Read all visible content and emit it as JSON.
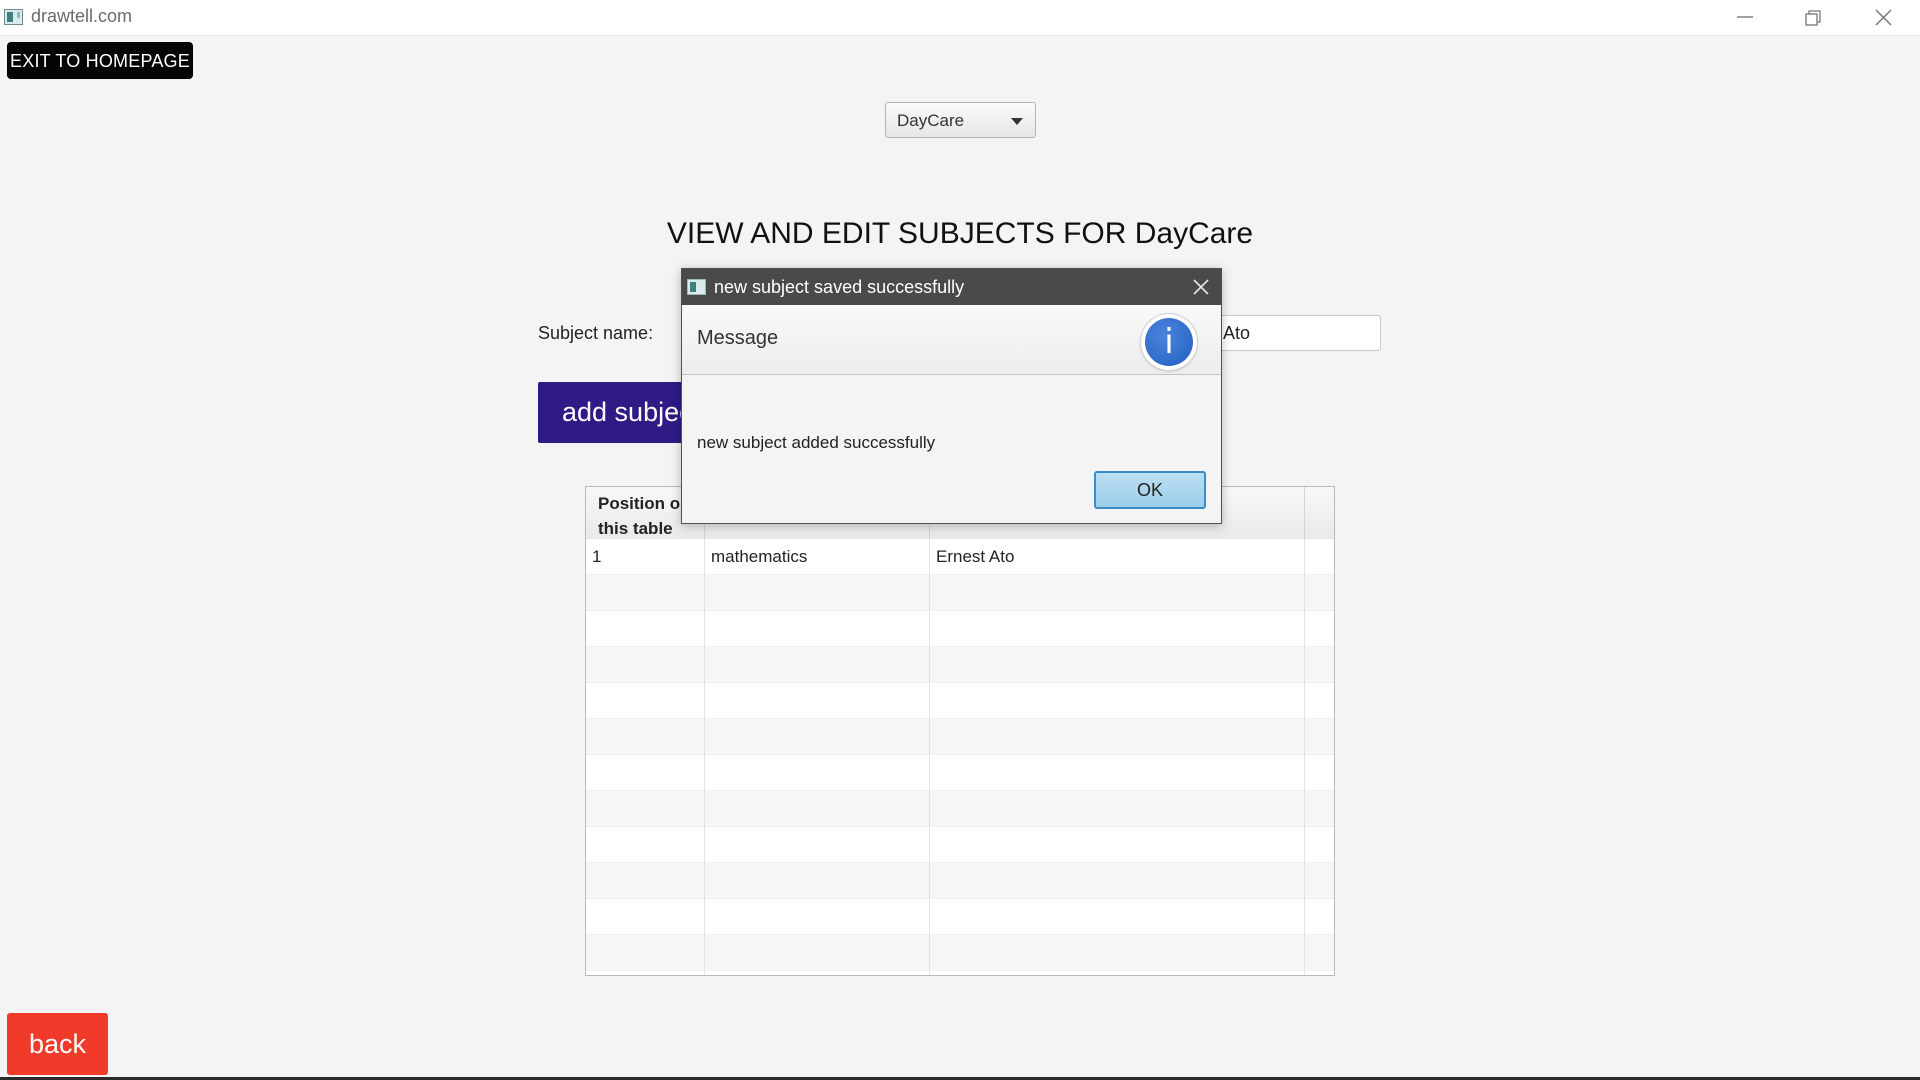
{
  "window": {
    "title": "drawtell.com"
  },
  "toolbar": {
    "exit_label": "EXIT TO HOMEPAGE"
  },
  "class_select": {
    "value": "DayCare"
  },
  "page": {
    "title": "VIEW AND EDIT SUBJECTS FOR DayCare"
  },
  "form": {
    "subject_label": "Subject name:",
    "teacher_value": "Ato",
    "add_button_label": "add subjec"
  },
  "table": {
    "headers": [
      "Position o\nthis table",
      "",
      "",
      ""
    ],
    "header_line1": "Position o",
    "header_line2": "this table",
    "rows": [
      {
        "position": "1",
        "subject": "mathematics",
        "teacher": "Ernest Ato"
      }
    ]
  },
  "back": {
    "label": "back"
  },
  "dialog": {
    "title": "new subject saved successfully",
    "header": "Message",
    "content": "new subject added successfully",
    "ok_label": "OK"
  },
  "colors": {
    "add_button": "#2f1a86",
    "back_button": "#f23a2b",
    "exit_button": "#050505",
    "dialog_titlebar": "#4a4a4a",
    "info_icon": "#2a67c8"
  }
}
